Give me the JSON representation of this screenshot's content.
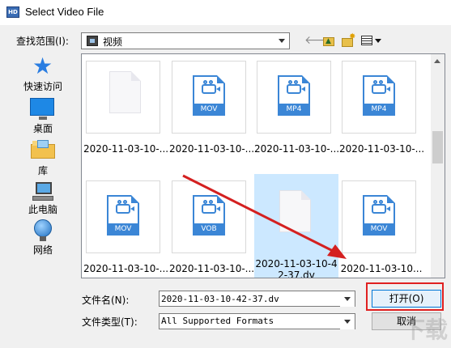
{
  "window": {
    "title": "Select Video File",
    "app_icon": "video-app-icon"
  },
  "lookin": {
    "label": "查找范围(I):",
    "value": "视频"
  },
  "toolbar": {
    "back": "back-arrow-icon",
    "up": "up-folder-icon",
    "new_folder": "new-folder-icon",
    "view_menu": "view-menu-icon",
    "back_glyph": "🡐"
  },
  "places": [
    {
      "label": "快速访问",
      "icon": "quick-access-star-icon"
    },
    {
      "label": "桌面",
      "icon": "desktop-icon"
    },
    {
      "label": "库",
      "icon": "library-icon"
    },
    {
      "label": "此电脑",
      "icon": "this-pc-icon"
    },
    {
      "label": "网络",
      "icon": "network-icon"
    }
  ],
  "files": [
    {
      "name": "2020-11-03-10-...",
      "type": "blank"
    },
    {
      "name": "2020-11-03-10-...",
      "type": "video",
      "ext": "MOV"
    },
    {
      "name": "2020-11-03-10-...",
      "type": "video",
      "ext": "MP4"
    },
    {
      "name": "2020-11-03-10-...",
      "type": "video",
      "ext": "MP4"
    },
    {
      "name": "2020-11-03-10-...",
      "type": "video",
      "ext": "MOV"
    },
    {
      "name": "2020-11-03-10-...",
      "type": "video",
      "ext": "VOB"
    },
    {
      "name": "2020-11-03-10-42-37.dv",
      "type": "blank",
      "selected": true
    },
    {
      "name": "2020-11-03-10...",
      "type": "video",
      "ext": "MOV"
    }
  ],
  "filename": {
    "label": "文件名(N):",
    "value": "2020-11-03-10-42-37.dv"
  },
  "filetype": {
    "label": "文件类型(T):",
    "value": "All Supported Formats"
  },
  "buttons": {
    "open": "打开(O)",
    "cancel": "取消"
  },
  "watermark": "下载",
  "colors": {
    "accent": "#0078d7",
    "selection": "#cce8ff",
    "video_icon": "#3b86d6",
    "annotation": "#e02020"
  }
}
